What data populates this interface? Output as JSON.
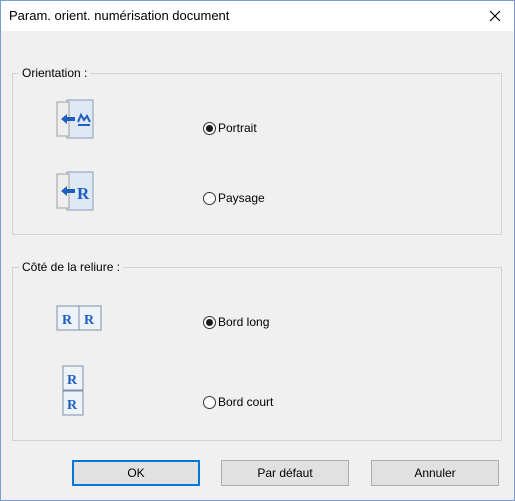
{
  "dialog": {
    "title": "Param. orient. numérisation document"
  },
  "orientation": {
    "label": "Orientation :",
    "options": [
      {
        "label": "Portrait",
        "selected": true,
        "icon": "portrait-orientation-icon"
      },
      {
        "label": "Paysage",
        "selected": false,
        "icon": "landscape-orientation-icon"
      }
    ]
  },
  "binding": {
    "label": "Côté de la reliure :",
    "options": [
      {
        "label": "Bord long",
        "selected": true,
        "icon": "long-edge-binding-icon"
      },
      {
        "label": "Bord court",
        "selected": false,
        "icon": "short-edge-binding-icon"
      }
    ]
  },
  "buttons": {
    "ok": "OK",
    "default": "Par défaut",
    "cancel": "Annuler"
  },
  "colors": {
    "accent": "#0078d7",
    "icon_blue": "#1f5fbf",
    "icon_page": "#dfe8f5"
  }
}
